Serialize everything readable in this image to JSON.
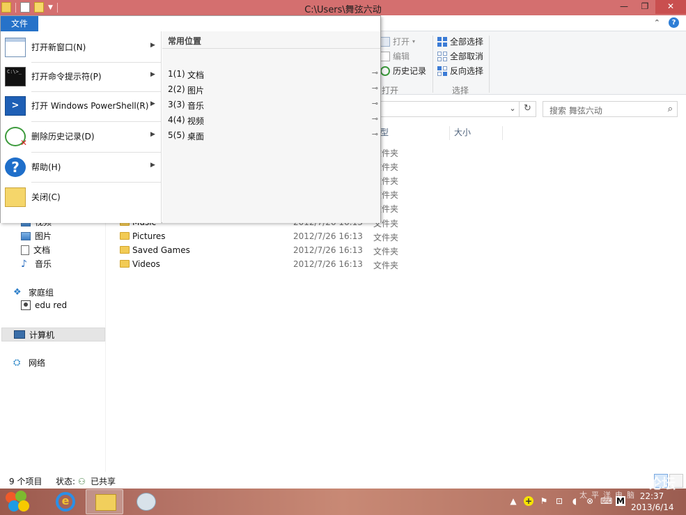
{
  "window": {
    "title": "C:\\Users\\舞弦六动",
    "min_glyph": "—",
    "max_glyph": "❐",
    "close_glyph": "✕"
  },
  "ribbon": {
    "file_tab": "文件",
    "open_group": {
      "open": "打开",
      "edit": "编辑",
      "history": "历史记录",
      "label": "打开"
    },
    "select_group": {
      "select_all": "全部选择",
      "select_none": "全部取消",
      "invert": "反向选择",
      "label": "选择"
    }
  },
  "address": {
    "dropdown_glyph": "⌄",
    "refresh_glyph": "↻",
    "search_placeholder": "搜索 舞弦六动",
    "search_glyph": "⌕"
  },
  "columns": {
    "type": "型",
    "size": "大小"
  },
  "nav": {
    "partial_video": "视频",
    "items": [
      {
        "label": "图片"
      },
      {
        "label": "文档"
      },
      {
        "label": "音乐"
      }
    ],
    "homegroup": "家庭组",
    "user": "edu red",
    "computer": "计算机",
    "network": "网络"
  },
  "type_column_visible": [
    "文件夹",
    "文件夹",
    "文件夹",
    "文件夹",
    "文件夹"
  ],
  "files": [
    {
      "name": "Music",
      "date": "2012/7/26 16:13",
      "type": "文件夹"
    },
    {
      "name": "Pictures",
      "date": "2012/7/26 16:13",
      "type": "文件夹"
    },
    {
      "name": "Saved Games",
      "date": "2012/7/26 16:13",
      "type": "文件夹"
    },
    {
      "name": "Videos",
      "date": "2012/7/26 16:13",
      "type": "文件夹"
    }
  ],
  "status": {
    "items": "9 个项目",
    "state": "状态:",
    "shared": "已共享"
  },
  "file_menu": {
    "tab": "文件",
    "items": [
      {
        "label": "打开新窗口(N)"
      },
      {
        "label": "打开命令提示符(P)"
      },
      {
        "label": "打开 Windows PowerShell(R)"
      },
      {
        "label": "删除历史记录(D)"
      },
      {
        "label": "帮助(H)"
      },
      {
        "label": "关闭(C)"
      }
    ],
    "frequent_header": "常用位置",
    "places": [
      {
        "num": "1(1)",
        "name": "文档"
      },
      {
        "num": "2(2)",
        "name": "图片"
      },
      {
        "num": "3(3)",
        "name": "音乐"
      },
      {
        "num": "4(4)",
        "name": "视频"
      },
      {
        "num": "5(5)",
        "name": "桌面"
      }
    ],
    "pin_glyph": "⊸",
    "arrow_glyph": "▶"
  },
  "taskbar": {
    "clock_time": "22:37",
    "clock_date": "2013/6/14",
    "ie_glyph": "e"
  },
  "watermark": {
    "brand": "Pconline",
    "sub": "太平洋电脑",
    "forum": "论坛"
  }
}
